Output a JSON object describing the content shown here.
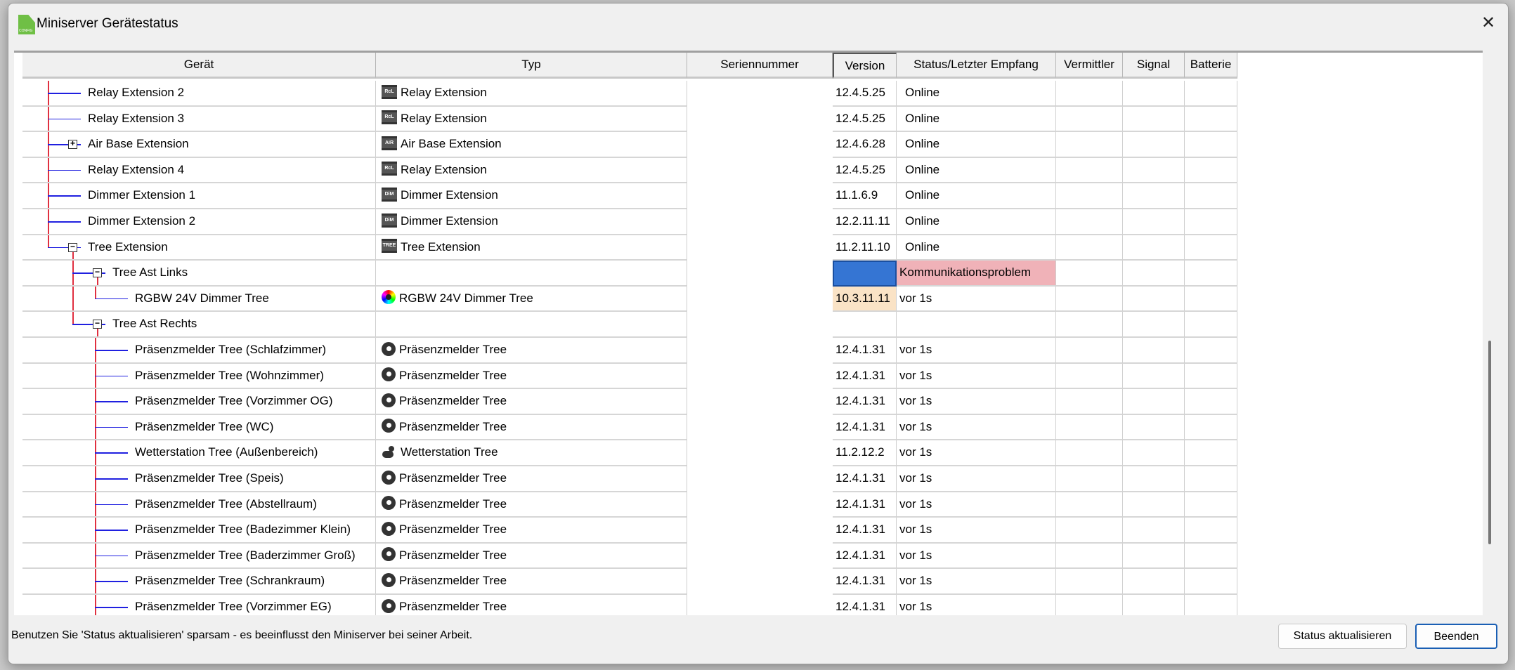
{
  "window": {
    "title": "Miniserver Gerätestatus",
    "app_icon_text": "CONFIG",
    "close_icon": "close-icon"
  },
  "columns": [
    "Gerät",
    "Typ",
    "Seriennummer",
    "Version",
    "Status/Letzter Empfang",
    "Vermittler",
    "Signal",
    "Batterie"
  ],
  "rows": [
    {
      "name": "Relay Extension 2",
      "level": 1,
      "exp": "",
      "last": false,
      "type": "Relay Extension",
      "icon": "relay",
      "iconText": "RcL",
      "version": "12.4.5.25",
      "status": "Online"
    },
    {
      "name": "Relay Extension 3",
      "level": 1,
      "exp": "",
      "last": false,
      "type": "Relay Extension",
      "icon": "relay",
      "iconText": "RcL",
      "version": "12.4.5.25",
      "status": "Online"
    },
    {
      "name": "Air Base Extension",
      "level": 1,
      "exp": "+",
      "last": false,
      "type": "Air Base Extension",
      "icon": "air",
      "iconText": "AiR",
      "version": "12.4.6.28",
      "status": "Online"
    },
    {
      "name": "Relay Extension 4",
      "level": 1,
      "exp": "",
      "last": false,
      "type": "Relay Extension",
      "icon": "relay",
      "iconText": "RcL",
      "version": "12.4.5.25",
      "status": "Online"
    },
    {
      "name": "Dimmer Extension 1",
      "level": 1,
      "exp": "",
      "last": false,
      "type": "Dimmer Extension",
      "icon": "dimmer",
      "iconText": "DiM",
      "version": "11.1.6.9",
      "status": "Online"
    },
    {
      "name": "Dimmer Extension 2",
      "level": 1,
      "exp": "",
      "last": false,
      "type": "Dimmer Extension",
      "icon": "dimmer",
      "iconText": "DiM",
      "version": "12.2.11.11",
      "status": "Online"
    },
    {
      "name": "Tree Extension",
      "level": 1,
      "exp": "-",
      "last": true,
      "type": "Tree Extension",
      "icon": "tree",
      "iconText": "TREE",
      "version": "11.2.11.10",
      "status": "Online"
    },
    {
      "name": "Tree Ast Links",
      "level": 2,
      "exp": "-",
      "last": false,
      "type": "",
      "icon": "",
      "version": "",
      "status": "Kommunikationsproblem",
      "versionBg": "#3575d3",
      "statusBg": "#f0b2b8"
    },
    {
      "name": "RGBW 24V Dimmer Tree",
      "level": 3,
      "exp": "",
      "last": true,
      "type": "RGBW 24V Dimmer Tree",
      "icon": "rgbw",
      "version": "10.3.11.11",
      "status": "vor 1s",
      "versionBg": "#fae3c6"
    },
    {
      "name": "Tree Ast Rechts",
      "level": 2,
      "exp": "-",
      "last": true,
      "type": "",
      "icon": "",
      "version": "",
      "status": ""
    },
    {
      "name": "Präsenzmelder Tree (Schlafzimmer)",
      "level": 3,
      "exp": "",
      "last": false,
      "type": "Präsenzmelder Tree",
      "icon": "presence",
      "version": "12.4.1.31",
      "status": "vor 1s"
    },
    {
      "name": "Präsenzmelder Tree (Wohnzimmer)",
      "level": 3,
      "exp": "",
      "last": false,
      "type": "Präsenzmelder Tree",
      "icon": "presence",
      "version": "12.4.1.31",
      "status": "vor 1s"
    },
    {
      "name": "Präsenzmelder Tree (Vorzimmer OG)",
      "level": 3,
      "exp": "",
      "last": false,
      "type": "Präsenzmelder Tree",
      "icon": "presence",
      "version": "12.4.1.31",
      "status": "vor 1s"
    },
    {
      "name": "Präsenzmelder Tree (WC)",
      "level": 3,
      "exp": "",
      "last": false,
      "type": "Präsenzmelder Tree",
      "icon": "presence",
      "version": "12.4.1.31",
      "status": "vor 1s"
    },
    {
      "name": "Wetterstation Tree (Außenbereich)",
      "level": 3,
      "exp": "",
      "last": false,
      "type": "Wetterstation Tree",
      "icon": "weather",
      "version": "11.2.12.2",
      "status": "vor 1s"
    },
    {
      "name": "Präsenzmelder Tree (Speis)",
      "level": 3,
      "exp": "",
      "last": false,
      "type": "Präsenzmelder Tree",
      "icon": "presence",
      "version": "12.4.1.31",
      "status": "vor 1s"
    },
    {
      "name": "Präsenzmelder Tree (Abstellraum)",
      "level": 3,
      "exp": "",
      "last": false,
      "type": "Präsenzmelder Tree",
      "icon": "presence",
      "version": "12.4.1.31",
      "status": "vor 1s"
    },
    {
      "name": "Präsenzmelder Tree (Badezimmer Klein)",
      "level": 3,
      "exp": "",
      "last": false,
      "type": "Präsenzmelder Tree",
      "icon": "presence",
      "version": "12.4.1.31",
      "status": "vor 1s"
    },
    {
      "name": "Präsenzmelder Tree (Baderzimmer Groß)",
      "level": 3,
      "exp": "",
      "last": false,
      "type": "Präsenzmelder Tree",
      "icon": "presence",
      "version": "12.4.1.31",
      "status": "vor 1s"
    },
    {
      "name": "Präsenzmelder Tree (Schrankraum)",
      "level": 3,
      "exp": "",
      "last": false,
      "type": "Präsenzmelder Tree",
      "icon": "presence",
      "version": "12.4.1.31",
      "status": "vor 1s"
    },
    {
      "name": "Präsenzmelder Tree (Vorzimmer EG)",
      "level": 3,
      "exp": "",
      "last": false,
      "type": "Präsenzmelder Tree",
      "icon": "presence",
      "version": "12.4.1.31",
      "status": "vor 1s"
    }
  ],
  "footer": {
    "hint": "Benutzen Sie 'Status aktualisieren' sparsam - es beeinflusst den Miniserver bei seiner Arbeit.",
    "refresh_label": "Status aktualisieren",
    "close_label": "Beenden"
  }
}
